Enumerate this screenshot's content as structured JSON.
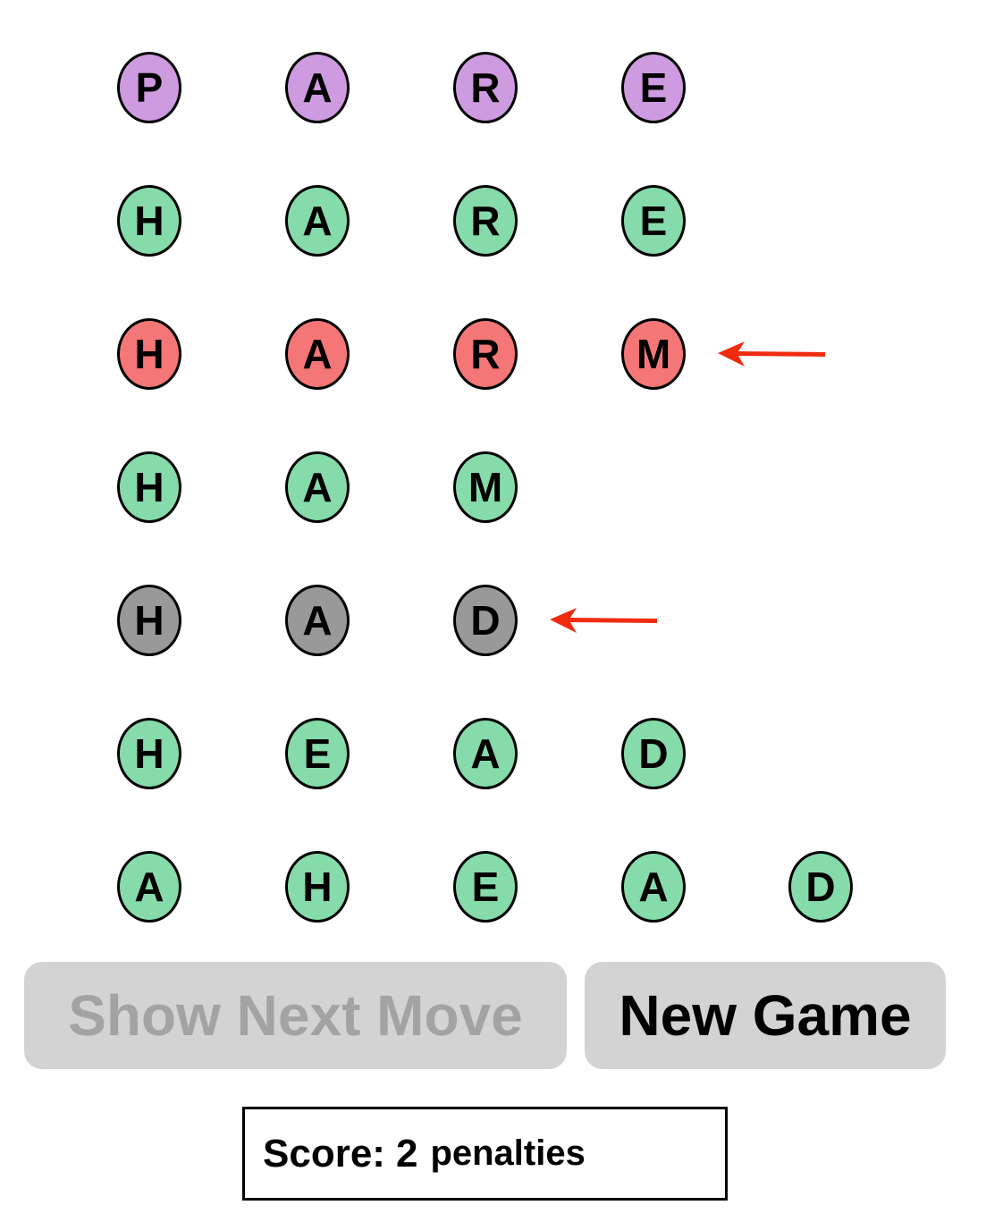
{
  "colors": {
    "purple": "#cf9be0",
    "green": "#86dbaa",
    "red": "#f57676",
    "gray": "#999999",
    "arrow": "#f02b10"
  },
  "board": {
    "rows": [
      {
        "status": "start",
        "letters": [
          "P",
          "A",
          "R",
          "E"
        ]
      },
      {
        "status": "valid",
        "letters": [
          "H",
          "A",
          "R",
          "E"
        ]
      },
      {
        "status": "error",
        "letters": [
          "H",
          "A",
          "R",
          "M"
        ],
        "flagged": true
      },
      {
        "status": "valid",
        "letters": [
          "H",
          "A",
          "M"
        ]
      },
      {
        "status": "undone",
        "letters": [
          "H",
          "A",
          "D"
        ],
        "flagged": true
      },
      {
        "status": "valid",
        "letters": [
          "H",
          "E",
          "A",
          "D"
        ]
      },
      {
        "status": "valid",
        "letters": [
          "A",
          "H",
          "E",
          "A",
          "D"
        ]
      }
    ]
  },
  "buttons": {
    "show_next_move": "Show Next Move",
    "new_game": "New Game"
  },
  "score": {
    "label": "Score:",
    "value": "2",
    "unit": "penalties"
  }
}
